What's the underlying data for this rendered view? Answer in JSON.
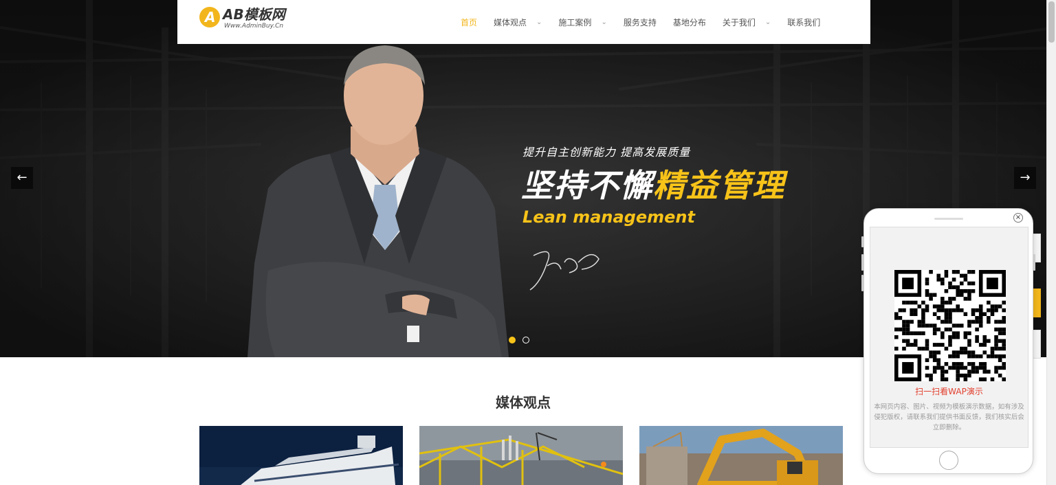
{
  "brand": {
    "logo_letter": "A",
    "title": "AB模板网",
    "subtitle": "Www.AdminBuy.Cn",
    "accent": "#f2b61c"
  },
  "nav": {
    "items": [
      {
        "label": "首页",
        "active": true,
        "has_dropdown": false
      },
      {
        "label": "媒体观点",
        "active": false,
        "has_dropdown": true
      },
      {
        "label": "施工案例",
        "active": false,
        "has_dropdown": true
      },
      {
        "label": "服务支持",
        "active": false,
        "has_dropdown": false
      },
      {
        "label": "基地分布",
        "active": false,
        "has_dropdown": false
      },
      {
        "label": "关于我们",
        "active": false,
        "has_dropdown": true
      },
      {
        "label": "联系我们",
        "active": false,
        "has_dropdown": false
      }
    ],
    "chevron": "⌄"
  },
  "hero": {
    "tagline": "提升自主创新能力 提高发展质量",
    "headline_white": "坚持不懈",
    "headline_yellow": "精益管理",
    "english": "Lean management",
    "highlight_color": "#f7c319",
    "prev_arrow": "←",
    "next_arrow": "→",
    "slides_total": 2,
    "active_slide": 1
  },
  "section": {
    "title": "媒体观点",
    "cards": [
      {
        "image": "cruise-ship"
      },
      {
        "image": "oil-platform"
      },
      {
        "image": "excavator"
      }
    ]
  },
  "popup": {
    "close_icon": "×",
    "qr_caption": "扫一扫看WAP演示",
    "note": "本网页内容、图片、视频为模板演示数据，如有涉及侵犯版权，请联系我们提供书面反馈，我们核实后会立即删除。"
  }
}
